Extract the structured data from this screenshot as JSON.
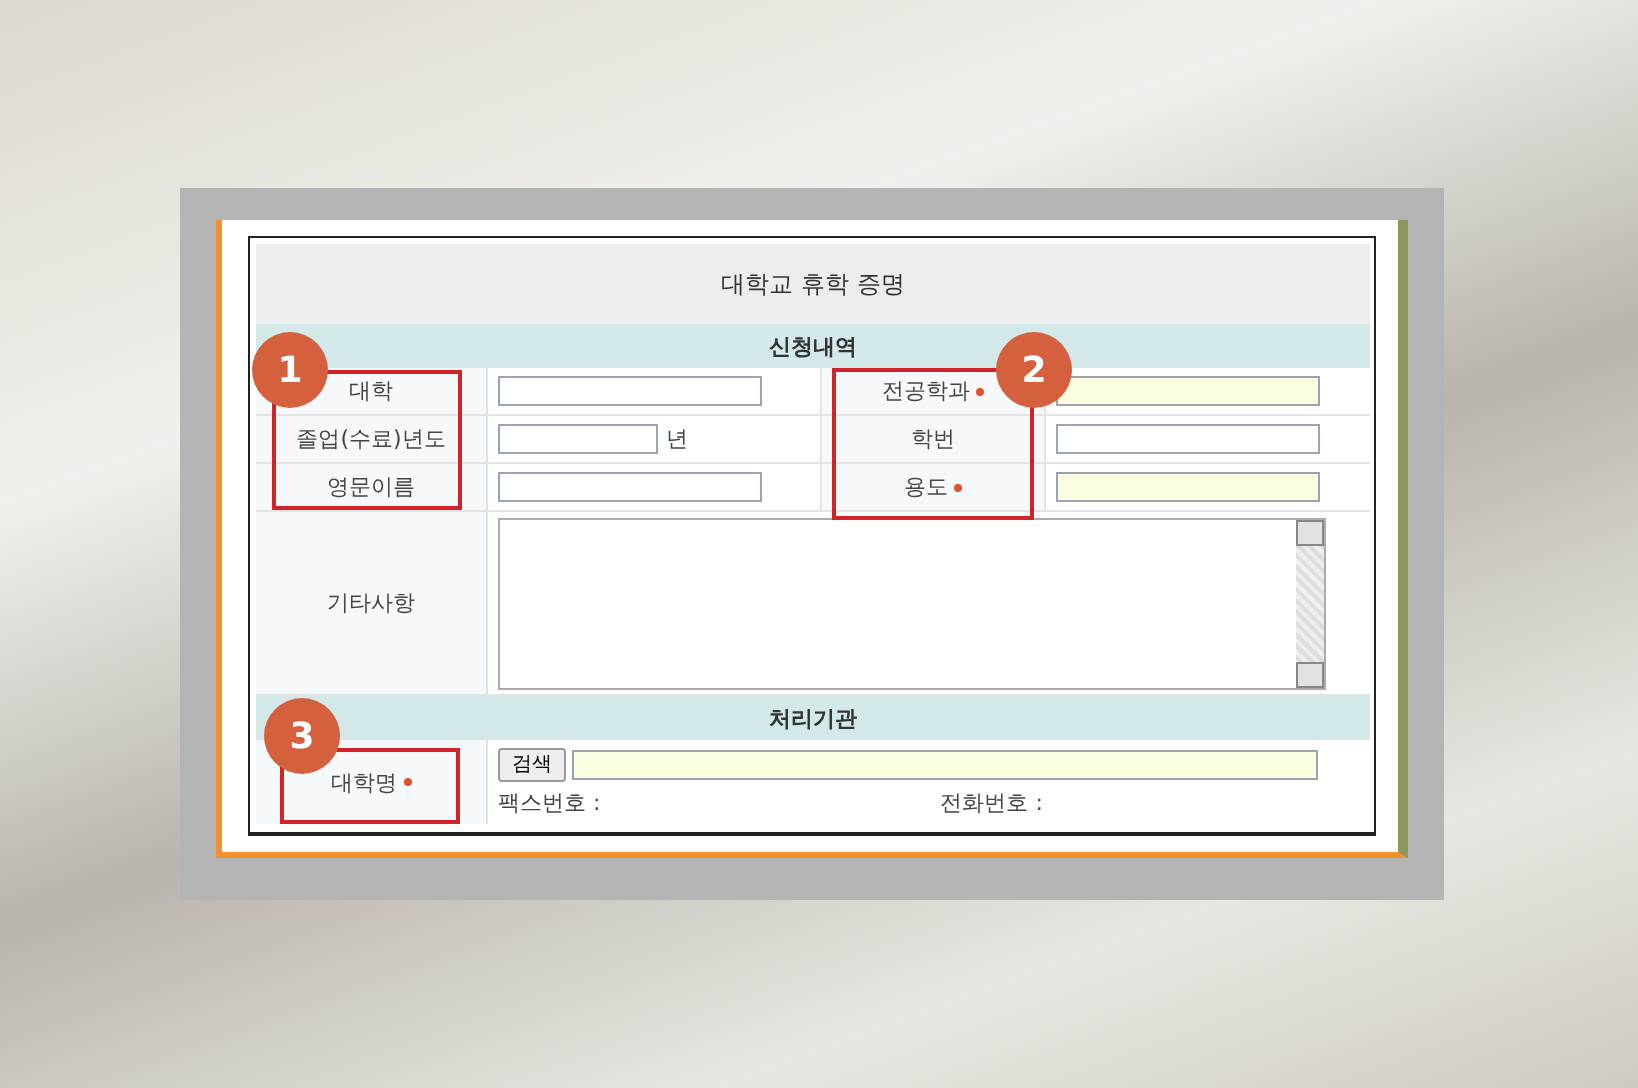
{
  "form": {
    "title": "대학교 휴학 증명",
    "sections": [
      {
        "heading": "신청내역",
        "rows": [
          {
            "kind": "pair",
            "fields": [
              {
                "label": "대학",
                "required": false,
                "highlighted": false,
                "kind": "text"
              },
              {
                "label": "전공학과",
                "required": true,
                "highlighted": true,
                "kind": "text"
              }
            ]
          },
          {
            "kind": "pair",
            "fields": [
              {
                "label": "졸업(수료)년도",
                "required": false,
                "highlighted": false,
                "kind": "year",
                "suffix": "년"
              },
              {
                "label": "학번",
                "required": false,
                "highlighted": false,
                "kind": "text"
              }
            ]
          },
          {
            "kind": "pair",
            "fields": [
              {
                "label": "영문이름",
                "required": false,
                "highlighted": false,
                "kind": "text"
              },
              {
                "label": "용도",
                "required": true,
                "highlighted": true,
                "kind": "text"
              }
            ]
          },
          {
            "kind": "textarea",
            "label": "기타사항"
          }
        ]
      },
      {
        "heading": "처리기관",
        "rows": [
          {
            "kind": "search",
            "label": "대학명",
            "required": true,
            "highlighted": true,
            "button": "검색",
            "fax_label": "팩스번호 :",
            "phone_label": "전화번호 :"
          }
        ]
      }
    ]
  },
  "callouts": [
    {
      "number": "1"
    },
    {
      "number": "2"
    },
    {
      "number": "3"
    }
  ]
}
